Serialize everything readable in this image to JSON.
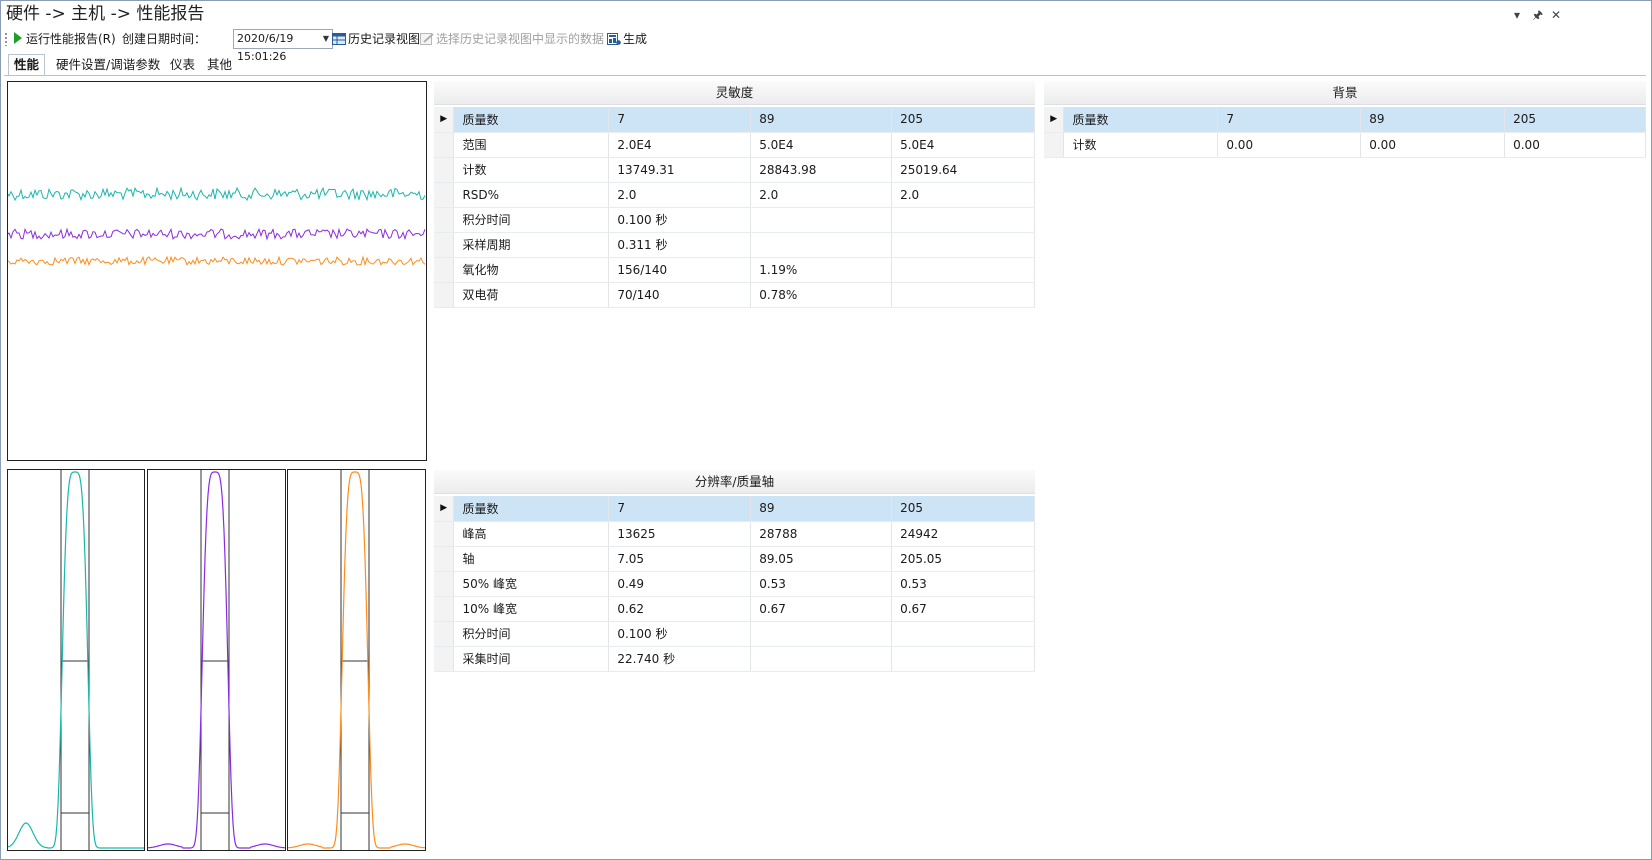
{
  "title": "硬件 -> 主机 -> 性能报告",
  "window_controls": {
    "dropdown": "▾",
    "pin": "🖈",
    "close": "✕"
  },
  "toolbar": {
    "run_label": "运行性能报告(R)",
    "created_label": "创建日期时间：",
    "datetime_value": "2020/6/19 15:01:26",
    "history_view_label": "历史记录视图",
    "select_history_label": "选择历史记录视图中显示的数据",
    "generate_label": "生成"
  },
  "tabs": [
    "性能",
    "硬件设置/调谐参数",
    "仪表",
    "其他"
  ],
  "colors": {
    "series_7": "#19b6ad",
    "series_89": "#8a2be2",
    "series_205": "#ff8c1a",
    "selected_row": "#cde4f7"
  },
  "sensitivity": {
    "title": "灵敏度",
    "rows": [
      [
        "质量数",
        "7",
        "89",
        "205"
      ],
      [
        "范围",
        "2.0E4",
        "5.0E4",
        "5.0E4"
      ],
      [
        "计数",
        "13749.31",
        "28843.98",
        "25019.64"
      ],
      [
        "RSD%",
        "2.0",
        "2.0",
        "2.0"
      ],
      [
        "积分时间",
        "0.100 秒",
        "",
        ""
      ],
      [
        "采样周期",
        "0.311 秒",
        "",
        ""
      ],
      [
        "氧化物",
        "156/140",
        "1.19%",
        ""
      ],
      [
        "双电荷",
        "70/140",
        "0.78%",
        ""
      ]
    ]
  },
  "background": {
    "title": "背景",
    "rows": [
      [
        "质量数",
        "7",
        "89",
        "205"
      ],
      [
        "计数",
        "0.00",
        "0.00",
        "0.00"
      ]
    ]
  },
  "resolution": {
    "title": "分辨率/质量轴",
    "rows": [
      [
        "质量数",
        "7",
        "89",
        "205"
      ],
      [
        "峰高",
        "13625",
        "28788",
        "24942"
      ],
      [
        "轴",
        "7.05",
        "89.05",
        "205.05"
      ],
      [
        "50% 峰宽",
        "0.49",
        "0.53",
        "0.53"
      ],
      [
        "10% 峰宽",
        "0.62",
        "0.67",
        "0.67"
      ],
      [
        "积分时间",
        "0.100 秒",
        "",
        ""
      ],
      [
        "采集时间",
        "22.740 秒",
        "",
        ""
      ]
    ]
  }
}
